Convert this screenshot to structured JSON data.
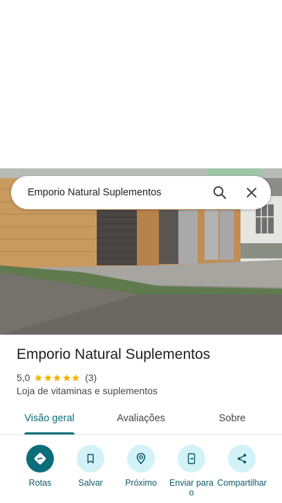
{
  "search": {
    "query": "Emporio Natural Suplementos"
  },
  "place": {
    "title": "Emporio Natural Suplementos",
    "rating": "5,0",
    "stars": 5,
    "reviews_count": "(3)",
    "category": "Loja de vitaminas e suplementos"
  },
  "tabs": [
    {
      "label": "Visão geral",
      "active": true
    },
    {
      "label": "Avaliações",
      "active": false
    },
    {
      "label": "Sobre",
      "active": false
    }
  ],
  "actions": [
    {
      "label": "Rotas",
      "icon": "directions-icon"
    },
    {
      "label": "Salvar",
      "icon": "bookmark-icon"
    },
    {
      "label": "Próximo",
      "icon": "nearby-icon"
    },
    {
      "label": "Enviar para o",
      "icon": "send-to-phone-icon"
    },
    {
      "label": "Compartilhar",
      "icon": "share-icon"
    }
  ],
  "colors": {
    "accent": "#0b6c7a",
    "action_bg": "#d3f2f7",
    "star": "#f4b400"
  }
}
